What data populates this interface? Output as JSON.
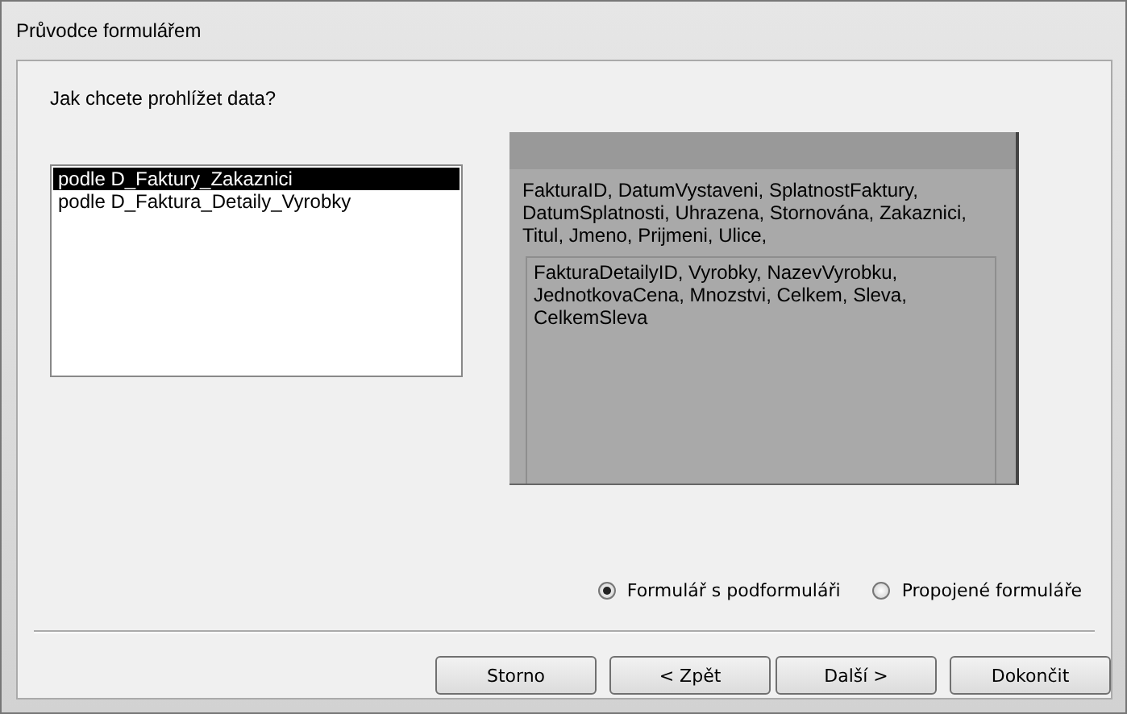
{
  "window": {
    "title": "Průvodce formulářem"
  },
  "question": "Jak chcete prohlížet data?",
  "views": [
    {
      "label": "podle D_Faktury_Zakaznici",
      "selected": true
    },
    {
      "label": "podle D_Faktura_Detaily_Vyrobky",
      "selected": false
    }
  ],
  "preview": {
    "main_fields": "FakturaID, DatumVystaveni, SplatnostFaktury, DatumSplatnosti, Uhrazena, Stornována, Zakaznici, Titul, Jmeno, Prijmeni, Ulice,",
    "sub_fields": "FakturaDetailyID, Vyrobky, NazevVyrobku, JednotkovaCena, Mnozstvi, Celkem, Sleva, CelkemSleva"
  },
  "layout_options": [
    {
      "label": "Formulář s podformuláři",
      "selected": true
    },
    {
      "label": "Propojené formuláře",
      "selected": false
    }
  ],
  "buttons": [
    {
      "label": "Storno",
      "disabled": false
    },
    {
      "label": "< Zpět",
      "disabled": false
    },
    {
      "label": "Další >",
      "disabled": false
    },
    {
      "label": "Dokončit",
      "disabled": false
    }
  ]
}
